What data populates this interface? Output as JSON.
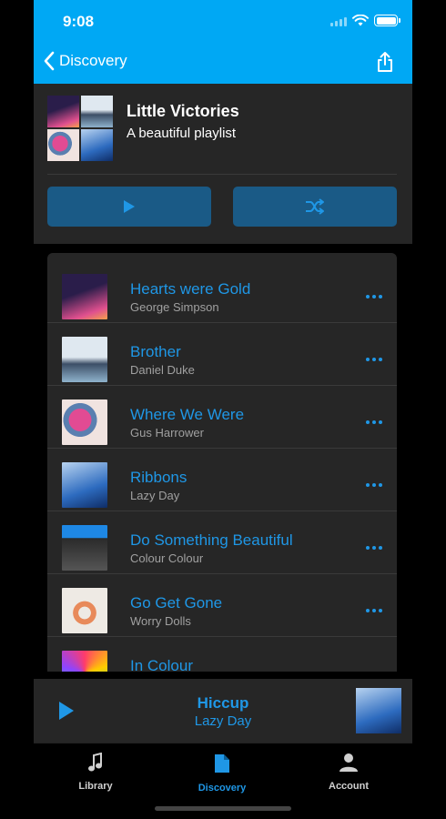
{
  "status": {
    "time": "9:08"
  },
  "nav": {
    "back_label": "Discovery"
  },
  "playlist": {
    "title": "Little Victories",
    "subtitle": "A beautiful playlist"
  },
  "tracks": [
    {
      "title": "Hearts were Gold",
      "artist": "George Simpson",
      "art_colors": [
        "#2a1d4a",
        "#e0508f",
        "#f4a14a"
      ]
    },
    {
      "title": "Brother",
      "artist": "Daniel Duke",
      "art_colors": [
        "#dfe8f0",
        "#3c4e66",
        "#8fb2cc"
      ]
    },
    {
      "title": "Where We Were",
      "artist": "Gus Harrower",
      "art_colors": [
        "#f0e3e0",
        "#e24b93",
        "#5a7fb0"
      ]
    },
    {
      "title": "Ribbons",
      "artist": "Lazy Day",
      "art_colors": [
        "#2d6bbf",
        "#b8d3f0",
        "#0f2d66"
      ]
    },
    {
      "title": "Do Something Beautiful",
      "artist": "Colour Colour",
      "art_colors": [
        "#2a2a2a",
        "#f4b400",
        "#1e88e5"
      ]
    },
    {
      "title": "Go Get Gone",
      "artist": "Worry Dolls",
      "art_colors": [
        "#eeeae4",
        "#e88a5a",
        "#bdb6ab"
      ]
    },
    {
      "title": "In Colour",
      "artist": "",
      "art_colors": [
        "#ff3b6b",
        "#ffcc00",
        "#2bb3ff"
      ]
    }
  ],
  "now_playing": {
    "title": "Hiccup",
    "artist": "Lazy Day"
  },
  "tabs": [
    {
      "label": "Library",
      "icon": "music-note-icon"
    },
    {
      "label": "Discovery",
      "icon": "document-icon"
    },
    {
      "label": "Account",
      "icon": "person-icon"
    }
  ],
  "colors": {
    "accent": "#00a8f4",
    "link": "#1f97e6",
    "surface": "#262626",
    "button": "#1a5a86"
  }
}
